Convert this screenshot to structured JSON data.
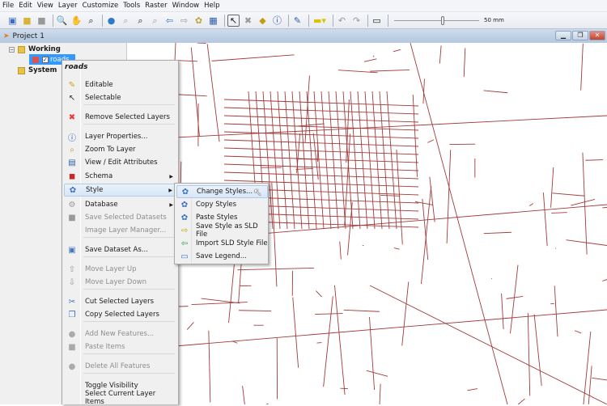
{
  "menubar": [
    "File",
    "Edit",
    "View",
    "Layer",
    "Customize",
    "Tools",
    "Raster",
    "Window",
    "Help"
  ],
  "toolbar": {
    "zoom_scale_label": "50 mm",
    "scale_slider_fraction": 0.56
  },
  "project": {
    "title": "Project 1"
  },
  "tree": {
    "working": "Working",
    "layer": "roads",
    "system": "System",
    "layer_color": "#d9534f"
  },
  "context_menu": {
    "header": "roads",
    "items": [
      {
        "label": "Editable",
        "icon": "pencil-icon",
        "enabled": true
      },
      {
        "label": "Selectable",
        "icon": "cursor-icon",
        "enabled": true
      },
      {
        "label": "Remove Selected Layers",
        "icon": "red-x-icon",
        "enabled": true
      },
      {
        "label": "Layer Properties...",
        "icon": "info-icon",
        "enabled": true
      },
      {
        "label": "Zoom To Layer",
        "icon": "magnifier-icon",
        "enabled": true
      },
      {
        "label": "View / Edit Attributes",
        "icon": "table-icon",
        "enabled": true
      },
      {
        "label": "Schema",
        "icon": "schema-icon",
        "enabled": true,
        "submenu": true
      },
      {
        "label": "Style",
        "icon": "palette-icon",
        "enabled": true,
        "submenu": true,
        "highlighted": true
      },
      {
        "label": "Database",
        "icon": "database-icon",
        "enabled": true,
        "submenu": true
      },
      {
        "label": "Save Selected Datasets",
        "icon": "stack-icon",
        "enabled": false
      },
      {
        "label": "Image Layer Manager...",
        "icon": "",
        "enabled": false
      },
      {
        "label": "Save Dataset As...",
        "icon": "floppy-icon",
        "enabled": true
      },
      {
        "label": "Move Layer Up",
        "icon": "arrow-up-icon",
        "enabled": false
      },
      {
        "label": "Move Layer Down",
        "icon": "arrow-down-icon",
        "enabled": false
      },
      {
        "label": "Cut Selected Layers",
        "icon": "cut-icon",
        "enabled": true
      },
      {
        "label": "Copy Selected Layers",
        "icon": "copy-icon",
        "enabled": true
      },
      {
        "label": "Add New Features...",
        "icon": "plus-circle-icon",
        "enabled": false
      },
      {
        "label": "Paste Items",
        "icon": "paste-icon",
        "enabled": false
      },
      {
        "label": "Delete All Features",
        "icon": "minus-circle-icon",
        "enabled": false
      },
      {
        "label": "Toggle Visibility",
        "icon": "",
        "enabled": true
      },
      {
        "label": "Select Current Layer Items",
        "icon": "",
        "enabled": true
      }
    ]
  },
  "style_submenu": [
    {
      "label": "Change Styles...",
      "icon": "palette-icon",
      "highlighted": true
    },
    {
      "label": "Copy Styles",
      "icon": "palette-icon"
    },
    {
      "label": "Paste Styles",
      "icon": "palette-icon"
    },
    {
      "label": "Save Style as SLD File",
      "icon": "sld-save-icon"
    },
    {
      "label": "Import SLD Style File",
      "icon": "sld-import-icon"
    },
    {
      "label": "Save Legend...",
      "icon": "legend-icon"
    }
  ],
  "colors": {
    "roads": "#a33a3a",
    "highlight": "#d7e6f7"
  }
}
